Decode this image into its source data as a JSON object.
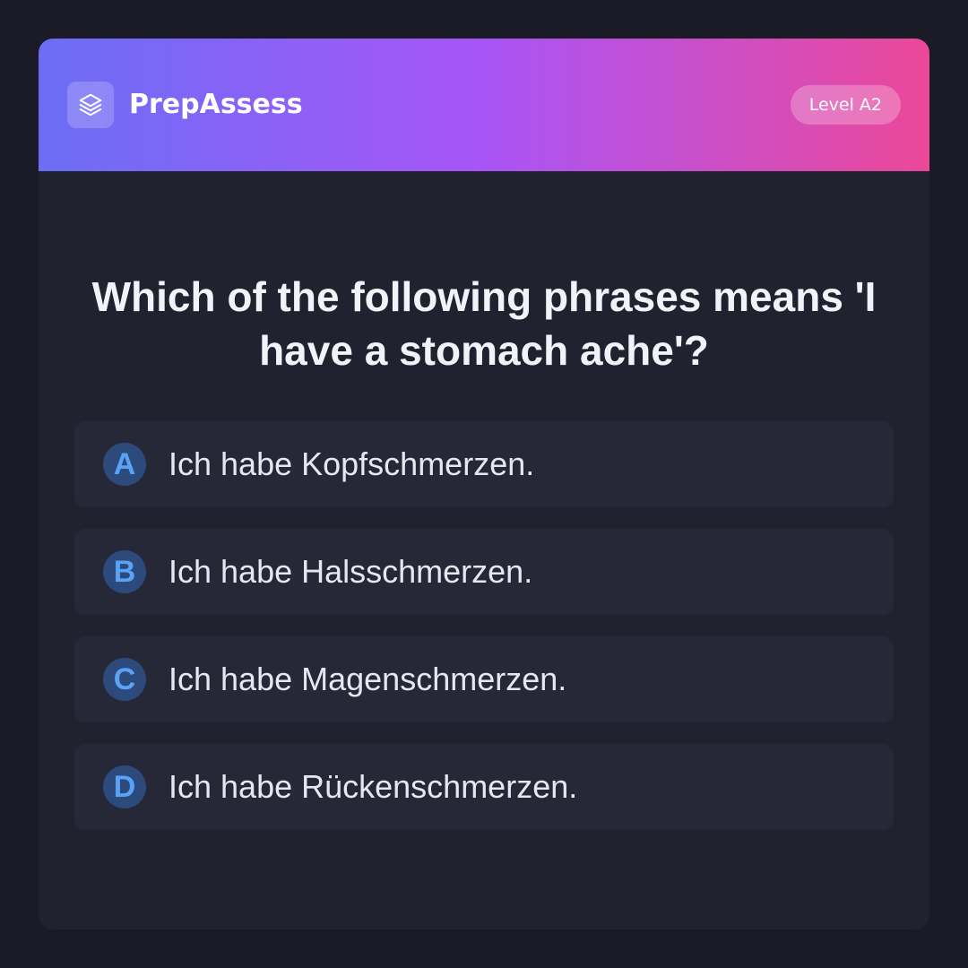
{
  "header": {
    "brand": "PrepAssess",
    "level": "Level A2",
    "logo_icon": "layers-icon"
  },
  "question": {
    "text": "Which of the following phrases means 'I have a stomach ache'?"
  },
  "options": [
    {
      "letter": "A",
      "text": "Ich habe Kopfschmerzen."
    },
    {
      "letter": "B",
      "text": "Ich habe Halsschmerzen."
    },
    {
      "letter": "C",
      "text": "Ich habe Magenschmerzen."
    },
    {
      "letter": "D",
      "text": "Ich habe Rückenschmerzen."
    }
  ],
  "colors": {
    "background": "#1a1b26",
    "card": "#20222f",
    "option_bg": "#262838",
    "gradient_start": "#6b6ef5",
    "gradient_mid": "#a855f7",
    "gradient_end": "#ec4899",
    "letter_bg": "#2c4a7c",
    "letter_fg": "#5aa2f5"
  }
}
